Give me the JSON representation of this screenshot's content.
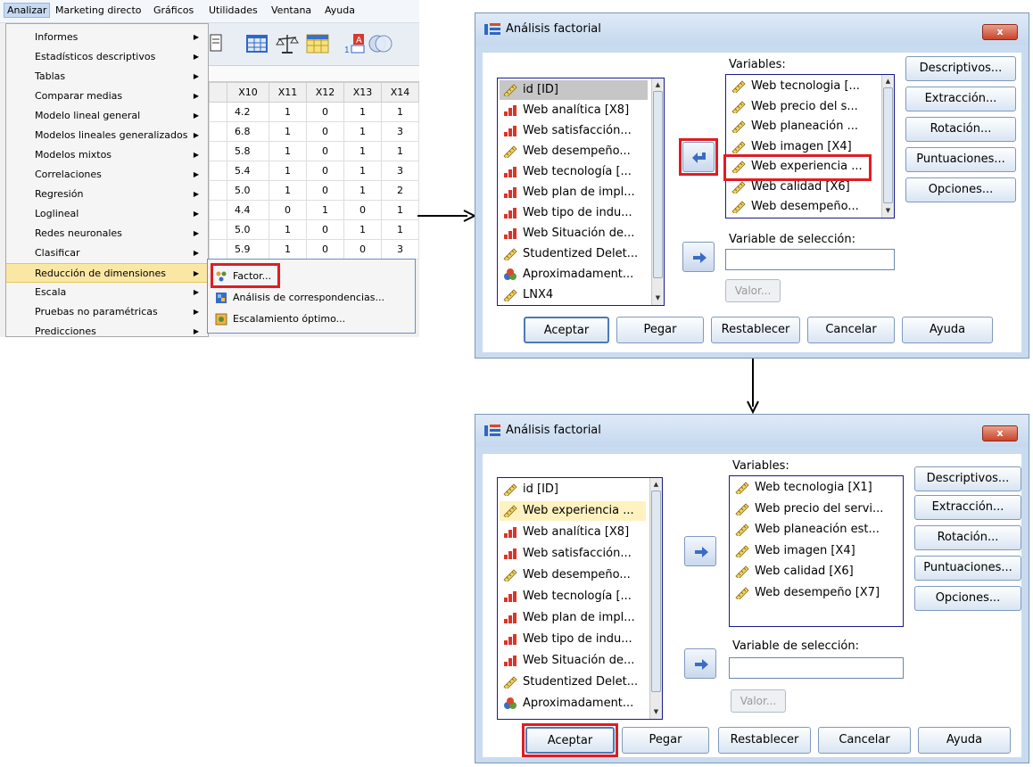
{
  "menubar": {
    "items": [
      "Analizar",
      "Marketing directo",
      "Gráficos",
      "Utilidades",
      "Ventana",
      "Ayuda"
    ]
  },
  "analizar_menu": {
    "items": [
      "Informes",
      "Estadísticos descriptivos",
      "Tablas",
      "Comparar medias",
      "Modelo lineal general",
      "Modelos lineales generalizados",
      "Modelos mixtos",
      "Correlaciones",
      "Regresión",
      "Loglineal",
      "Redes neuronales",
      "Clasificar",
      "Reducción de dimensiones",
      "Escala",
      "Pruebas no paramétricas",
      "Predicciones"
    ],
    "highlighted": "Reducción de dimensiones"
  },
  "reduccion_submenu": {
    "items": [
      "Factor...",
      "Análisis de correspondencias...",
      "Escalamiento óptimo..."
    ]
  },
  "data_grid": {
    "columns": [
      "X10",
      "X11",
      "X12",
      "X13",
      "X14"
    ],
    "rows": [
      [
        "4.2",
        "1",
        "0",
        "1",
        "1"
      ],
      [
        "6.8",
        "1",
        "0",
        "1",
        "3"
      ],
      [
        "5.8",
        "1",
        "0",
        "1",
        "1"
      ],
      [
        "5.4",
        "1",
        "0",
        "1",
        "3"
      ],
      [
        "5.0",
        "1",
        "0",
        "1",
        "2"
      ],
      [
        "4.4",
        "0",
        "1",
        "0",
        "1"
      ],
      [
        "5.0",
        "1",
        "0",
        "1",
        "1"
      ],
      [
        "5.9",
        "1",
        "0",
        "0",
        "3"
      ]
    ]
  },
  "dialog_common": {
    "title": "Análisis factorial",
    "close": "x",
    "variables_label": "Variables:",
    "seleccion_label": "Variable de selección:",
    "valor_button": "Valor...",
    "side_buttons": [
      "Descriptivos...",
      "Extracción...",
      "Rotación...",
      "Puntuaciones...",
      "Opciones..."
    ],
    "bottom_buttons": [
      "Aceptar",
      "Pegar",
      "Restablecer",
      "Cancelar",
      "Ayuda"
    ]
  },
  "dialog1": {
    "source_list": [
      {
        "label": "id [ID]",
        "icon": "scale"
      },
      {
        "label": "Web analítica [X8]",
        "icon": "ordinal"
      },
      {
        "label": "Web satisfacción...",
        "icon": "ordinal"
      },
      {
        "label": "Web desempeño...",
        "icon": "scale"
      },
      {
        "label": "Web tecnología [...",
        "icon": "ordinal"
      },
      {
        "label": "Web plan de impl...",
        "icon": "ordinal"
      },
      {
        "label": "Web tipo de indu...",
        "icon": "ordinal"
      },
      {
        "label": "Web Situación de...",
        "icon": "ordinal"
      },
      {
        "label": "Studentized Delet...",
        "icon": "scale"
      },
      {
        "label": "Aproximadament...",
        "icon": "nominal"
      },
      {
        "label": "LNX4",
        "icon": "scale"
      }
    ],
    "target_list": [
      "Web tecnologia [...",
      "Web precio del s...",
      "Web planeación ...",
      "Web imagen  [X4]",
      "Web experiencia ...",
      "Web calidad [X6]",
      "Web desempeño..."
    ]
  },
  "dialog2": {
    "source_list": [
      {
        "label": "id [ID]",
        "icon": "scale"
      },
      {
        "label": "Web experiencia ...",
        "icon": "scale"
      },
      {
        "label": "Web analítica [X8]",
        "icon": "ordinal"
      },
      {
        "label": "Web satisfacción...",
        "icon": "ordinal"
      },
      {
        "label": "Web desempeño...",
        "icon": "scale"
      },
      {
        "label": "Web tecnología [...",
        "icon": "ordinal"
      },
      {
        "label": "Web plan de impl...",
        "icon": "ordinal"
      },
      {
        "label": "Web tipo de indu...",
        "icon": "ordinal"
      },
      {
        "label": "Web Situación de...",
        "icon": "ordinal"
      },
      {
        "label": "Studentized Delet...",
        "icon": "scale"
      },
      {
        "label": "Aproximadament...",
        "icon": "nominal"
      }
    ],
    "target_list": [
      "Web tecnologia [X1]",
      "Web precio del servi...",
      "Web planeación est...",
      "Web imagen  [X4]",
      "Web calidad [X6]",
      "Web desempeño [X7]"
    ]
  },
  "colors": {
    "highlight_red": "#e01c24",
    "dialog_bg": "#c9dcef",
    "menu_highlight": "#fbe7a4",
    "selection_gray": "#c6c6c6"
  }
}
